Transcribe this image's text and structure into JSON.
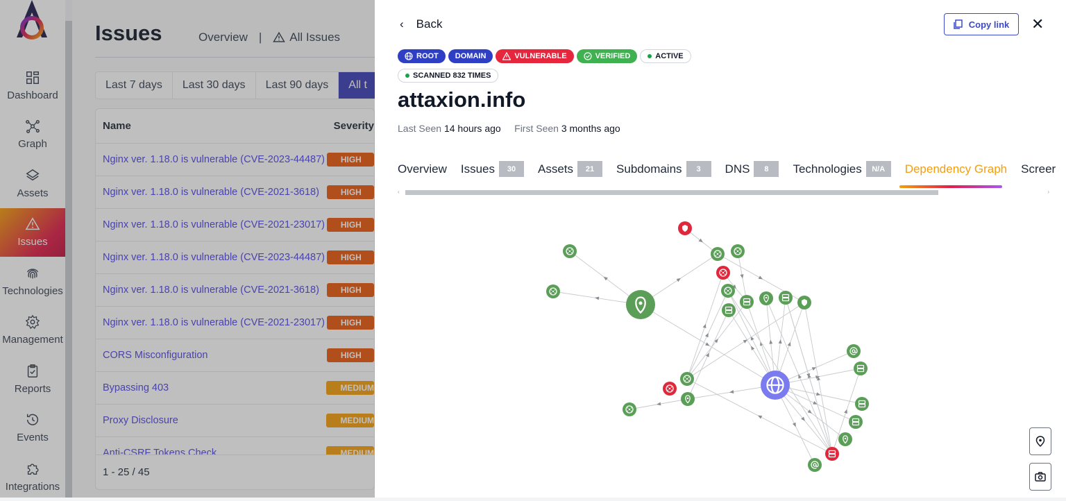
{
  "sidebar": {
    "items": [
      {
        "label": "Dashboard",
        "icon": "dashboard-icon"
      },
      {
        "label": "Graph",
        "icon": "graph-icon"
      },
      {
        "label": "Assets",
        "icon": "layers-icon"
      },
      {
        "label": "Issues",
        "icon": "warning-icon",
        "active": true
      },
      {
        "label": "Technologies",
        "icon": "fingerprint-icon"
      },
      {
        "label": "Management",
        "icon": "gear-icon"
      },
      {
        "label": "Reports",
        "icon": "clipboard-icon"
      },
      {
        "label": "Events",
        "icon": "history-icon"
      },
      {
        "label": "Integrations",
        "icon": "puzzle-icon"
      }
    ]
  },
  "issues": {
    "title": "Issues",
    "tabs": {
      "overview": "Overview",
      "separator": "|",
      "all": "All Issues"
    },
    "ranges": [
      "Last 7 days",
      "Last 30 days",
      "Last 90 days",
      "All t"
    ],
    "columns": {
      "name": "Name",
      "severity": "Severity"
    },
    "rows": [
      {
        "name": "Nginx ver. 1.18.0 is vulnerable (CVE-2023-44487)",
        "severity": "HIGH"
      },
      {
        "name": "Nginx ver. 1.18.0 is vulnerable (CVE-2021-3618)",
        "severity": "HIGH"
      },
      {
        "name": "Nginx ver. 1.18.0 is vulnerable (CVE-2021-23017)",
        "severity": "HIGH"
      },
      {
        "name": "Nginx ver. 1.18.0 is vulnerable (CVE-2023-44487)",
        "severity": "HIGH"
      },
      {
        "name": "Nginx ver. 1.18.0 is vulnerable (CVE-2021-3618)",
        "severity": "HIGH"
      },
      {
        "name": "Nginx ver. 1.18.0 is vulnerable (CVE-2021-23017)",
        "severity": "HIGH"
      },
      {
        "name": "CORS Misconfiguration",
        "severity": "HIGH"
      },
      {
        "name": "Bypassing 403",
        "severity": "MEDIUM"
      },
      {
        "name": "Proxy Disclosure",
        "severity": "MEDIUM"
      },
      {
        "name": "Anti-CSRF Tokens Check",
        "severity": "MEDIUM"
      }
    ],
    "pagination": "1 - 25 / 45"
  },
  "panel": {
    "back": "Back",
    "copy_link": "Copy link",
    "close": "✕",
    "badges": {
      "root": "ROOT",
      "domain": "DOMAIN",
      "vulnerable": "VULNERABLE",
      "verified": "VERIFIED",
      "active": "ACTIVE",
      "scanned": "SCANNED 832 TIMES"
    },
    "title": "attaxion.info",
    "last_seen_label": "Last Seen",
    "last_seen": "14 hours ago",
    "first_seen_label": "First Seen",
    "first_seen": "3 months ago",
    "tabs": [
      {
        "label": "Overview"
      },
      {
        "label": "Issues",
        "count": "30"
      },
      {
        "label": "Assets",
        "count": "21"
      },
      {
        "label": "Subdomains",
        "count": "3"
      },
      {
        "label": "DNS",
        "count": "8"
      },
      {
        "label": "Technologies",
        "count": "N/A"
      },
      {
        "label": "Dependency Graph",
        "active": true
      },
      {
        "label": "Screer"
      }
    ]
  },
  "colors": {
    "green": "#5a9e57",
    "red": "#e0283c",
    "purple": "#7b7bf0",
    "accent": "#f59e0b"
  }
}
